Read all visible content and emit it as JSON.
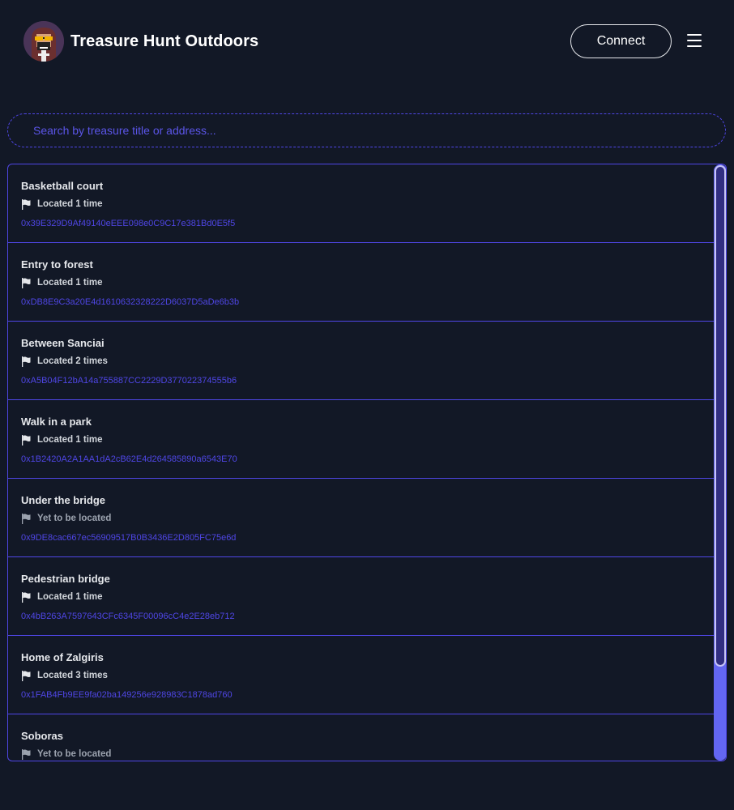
{
  "header": {
    "title": "Treasure Hunt Outdoors",
    "connect_label": "Connect"
  },
  "search": {
    "placeholder": "Search by treasure title or address..."
  },
  "treasures": [
    {
      "title": "Basketball court",
      "status": "Located 1 time",
      "address": "0x39E329D9Af49140eEEE098e0C9C17e381Bd0E5f5"
    },
    {
      "title": "Entry to forest",
      "status": "Located 1 time",
      "address": "0xDB8E9C3a20E4d1610632328222D6037D5aDe6b3b"
    },
    {
      "title": "Between Sanciai",
      "status": "Located 2 times",
      "address": "0xA5B04F12bA14a755887CC2229D377022374555b6"
    },
    {
      "title": "Walk in a park",
      "status": "Located 1 time",
      "address": "0x1B2420A2A1AA1dA2cB62E4d264585890a6543E70"
    },
    {
      "title": "Under the bridge",
      "status": "Yet to be located",
      "address": "0x9DE8cac667ec56909517B0B3436E2D805FC75e6d"
    },
    {
      "title": "Pedestrian bridge",
      "status": "Located 1 time",
      "address": "0x4bB263A7597643CFc6345F00096cC4e2E28eb712"
    },
    {
      "title": "Home of Zalgiris",
      "status": "Located 3 times",
      "address": "0x1FAB4Fb9EE9fa02ba149256e928983C1878ad760"
    },
    {
      "title": "Soboras",
      "status": "Yet to be located",
      "address": ""
    }
  ],
  "colors": {
    "background": "#121826",
    "accent": "#4f46e5",
    "scrollbar": "#6366f1"
  }
}
